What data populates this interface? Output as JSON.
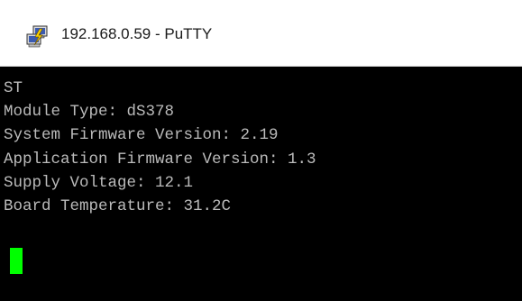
{
  "window": {
    "title": "192.168.0.59 - PuTTY",
    "icon": "putty-icon"
  },
  "terminal": {
    "lines": [
      "ST",
      "Module Type: dS378",
      "System Firmware Version: 2.19",
      "Application Firmware Version: 1.3",
      "Supply Voltage: 12.1",
      "Board Temperature: 31.2C"
    ],
    "colors": {
      "background": "#000000",
      "foreground": "#bbbbbb",
      "cursor": "#00ff00"
    }
  }
}
